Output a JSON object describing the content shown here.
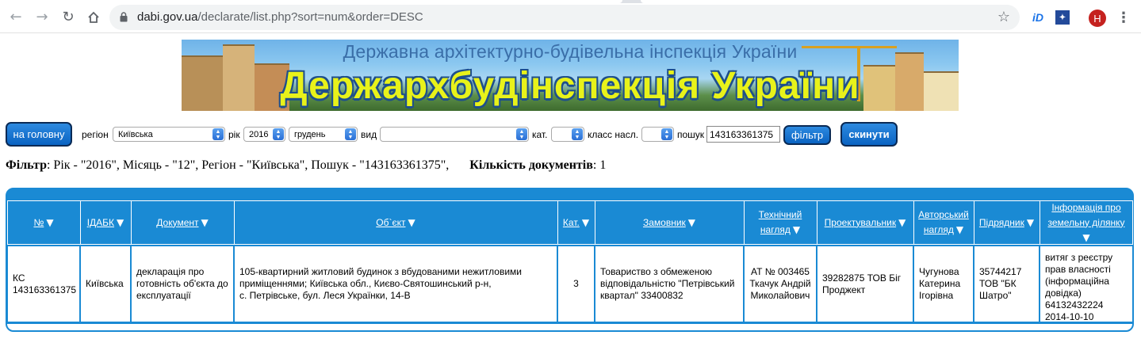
{
  "browser": {
    "url_host": "dabi.gov.ua",
    "url_path": "/declarate/list.php?sort=num&order=DESC",
    "profile_initial": "H",
    "extension_1": "iD"
  },
  "banner": {
    "subtitle": "Державна архітектурно-будівельна інспекція України",
    "title": "Держархбудінспекція України"
  },
  "filters": {
    "home_button": "на головну",
    "region_label": "регіон",
    "region_value": "Київська",
    "year_label": "рік",
    "year_value": "2016",
    "month_value": "грудень",
    "kind_label": "вид",
    "kind_value": "",
    "category_label": "кат.",
    "category_value": "",
    "class_label": "класс насл.",
    "class_value": "",
    "search_label": "пошук",
    "search_value": "143163361375",
    "filter_button": "фільтр",
    "reset_button": "скинути"
  },
  "summary": {
    "filter_label": "Фільтр",
    "filter_text": ": Рік - \"2016\", Місяць - \"12\", Регіон - \"Київська\", Пошук - \"143163361375\",",
    "count_label": "Кількість документів",
    "count_value": ": 1"
  },
  "table": {
    "headers": [
      {
        "line1": "№",
        "line2": ""
      },
      {
        "line1": "ІДАБК",
        "line2": ""
      },
      {
        "line1": "Документ",
        "line2": ""
      },
      {
        "line1": "Об`єкт",
        "line2": ""
      },
      {
        "line1": "Кат.",
        "line2": ""
      },
      {
        "line1": "Замовник",
        "line2": ""
      },
      {
        "line1": "Технічний",
        "line2": "нагляд"
      },
      {
        "line1": "Проектувальник",
        "line2": ""
      },
      {
        "line1": "Авторський",
        "line2": "нагляд"
      },
      {
        "line1": "Підрядник",
        "line2": ""
      },
      {
        "line1": "Інформація про",
        "line2": "земельну ділянку"
      }
    ],
    "sort_icon": "▼",
    "row": {
      "num_1": "КС",
      "num_2": "143163361375",
      "idabk": "Київська",
      "document_1": "декларація про",
      "document_2": "готовність об'єкта до",
      "document_3": "експлуатації",
      "object_1": "105-квартирний житловий будинок з вбудованими нежитловими",
      "object_2": "приміщеннями; Київська обл., Києво-Святошинський р-н,",
      "object_3": "с. Петрівське, бул. Леся Українки, 14-В",
      "category": "3",
      "customer_1": "Товариство з обмеженою",
      "customer_2": "відповідальністю \"Петрівський",
      "customer_3": "квартал\" 33400832",
      "tech_1": "АТ № 003465",
      "tech_2": "Ткачук Андрій",
      "tech_3": "Миколайович",
      "designer_1": "39282875 ТОВ Біг",
      "designer_2": "Проджект",
      "author_1": "Чугунова",
      "author_2": "Катерина",
      "author_3": "Ігорівна",
      "contractor_1": "35744217",
      "contractor_2": "ТОВ \"БК",
      "contractor_3": "Шатро\"",
      "land_1": "витяг з реєстру",
      "land_2": "прав власності",
      "land_3": "(інформаційна",
      "land_4": "довідка)",
      "land_5": "64132432224",
      "land_6": "2014-10-10"
    }
  },
  "colors": {
    "table_blue": "#1a8ad4",
    "button_blue": "#0a63c2",
    "banner_title_yellow": "#e8f21a"
  }
}
